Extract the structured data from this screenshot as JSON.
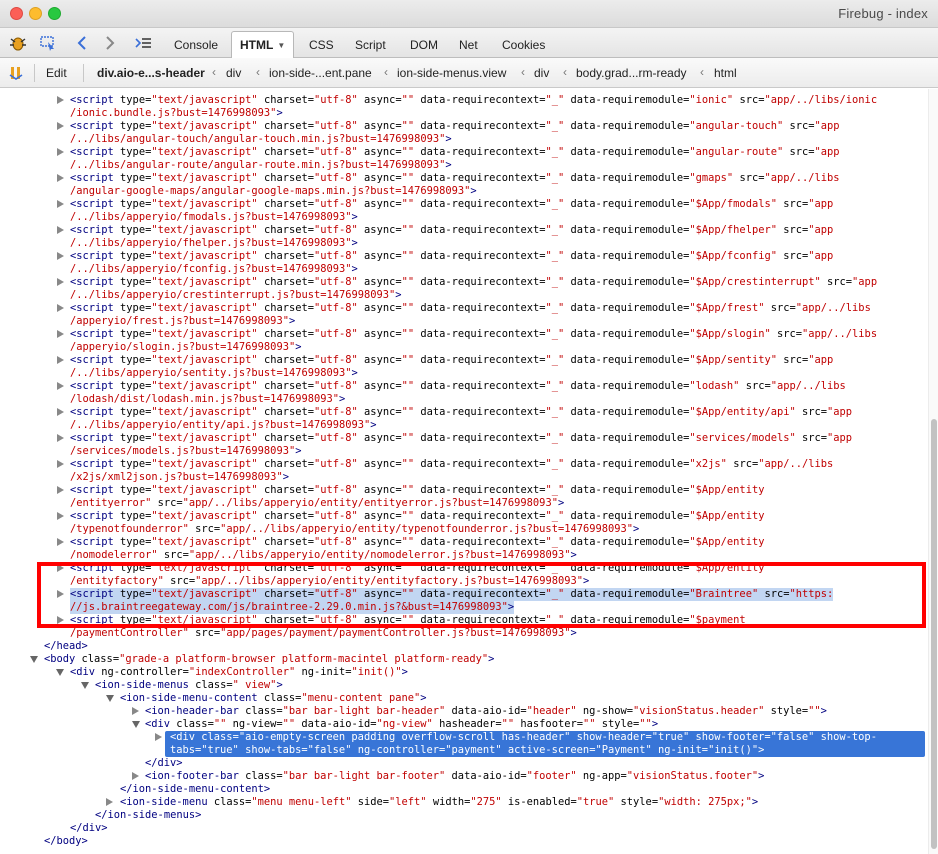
{
  "window": {
    "title": "Firebug - index"
  },
  "toolbar": {
    "tabs": [
      {
        "label": "Console"
      },
      {
        "label": "HTML",
        "active": true,
        "caret": "▼"
      },
      {
        "label": "CSS"
      },
      {
        "label": "Script"
      },
      {
        "label": "DOM"
      },
      {
        "label": "Net"
      },
      {
        "label": "Cookies"
      }
    ]
  },
  "breadcrumb": {
    "edit_label": "Edit",
    "items": [
      "div.aio-e...s-header",
      "div",
      "ion-side-...ent.pane",
      "ion-side-menus.view",
      "div",
      "body.grad...rm-ready",
      "html"
    ],
    "separator": "‹"
  },
  "code": {
    "script_lines": [
      [
        "ionic",
        "app/../libs/ionic",
        "/ionic.bundle.js?bust=1476998093\">"
      ],
      [
        "angular-touch",
        "app",
        "/../libs/angular-touch/angular-touch.min.js?bust=1476998093\">"
      ],
      [
        "angular-route",
        "app",
        "/../libs/angular-route/angular-route.min.js?bust=1476998093\">"
      ],
      [
        "gmaps",
        "app/../libs",
        "/angular-google-maps/angular-google-maps.min.js?bust=1476998093\">"
      ],
      [
        "$App/fmodals",
        "app",
        "/../libs/apperyio/fmodals.js?bust=1476998093\">"
      ],
      [
        "$App/fhelper",
        "app",
        "/../libs/apperyio/fhelper.js?bust=1476998093\">"
      ],
      [
        "$App/fconfig",
        "app",
        "/../libs/apperyio/fconfig.js?bust=1476998093\">"
      ],
      [
        "$App/crestinterrupt",
        "app",
        "/../libs/apperyio/crestinterrupt.js?bust=1476998093\">"
      ],
      [
        "$App/frest",
        "app/../libs",
        "/apperyio/frest.js?bust=1476998093\">"
      ],
      [
        "$App/slogin",
        "app/../libs",
        "/apperyio/slogin.js?bust=1476998093\">"
      ],
      [
        "$App/sentity",
        "app",
        "/../libs/apperyio/sentity.js?bust=1476998093\">"
      ],
      [
        "lodash",
        "app/../libs",
        "/lodash/dist/lodash.min.js?bust=1476998093\">"
      ],
      [
        "$App/entity/api",
        "app",
        "/../libs/apperyio/entity/api.js?bust=1476998093\">"
      ],
      [
        "services/models",
        "app",
        "/services/models.js?bust=1476998093\">"
      ],
      [
        "x2js",
        "app/../libs",
        "/x2js/xml2json.js?bust=1476998093\">"
      ]
    ],
    "prefix_text": "<script type=\"text/javascript\" charset=\"utf-8\" async=\"\" data-requirecontext=\"_\" data-requiremodule=",
    "entity_lines": [
      {
        "module": "\"$App/entity",
        "cont": "/entityerror\" src=\"app/../libs/apperyio/entity/entityerror.js?bust=1476998093\">"
      },
      {
        "module": "\"$App/entity",
        "cont": "/typenotfounderror\" src=\"app/../libs/apperyio/entity/typenotfounderror.js?bust=1476998093\">"
      },
      {
        "module": "\"$App/entity",
        "cont": "/nomodelerror\" src=\"app/../libs/apperyio/entity/nomodelerror.js?bust=1476998093\">"
      },
      {
        "module": "\"$App/entity",
        "cont": "/entityfactory\" src=\"app/../libs/apperyio/entity/entityfactory.js?bust=1476998093\">"
      }
    ],
    "braintree": {
      "module": "\"Braintree\"",
      "src_start": "\"https:",
      "src_cont": "//js.braintreegateway.com/js/braintree-2.29.0.min.js?&bust=1476998093\">"
    },
    "payment": {
      "module": "\"$payment",
      "cont": "/paymentController\" src=\"app/pages/payment/paymentController.js?bust=1476998093\">"
    },
    "tail": [
      "</head>",
      "<body class=\"grade-a platform-browser platform-macintel platform-ready\">",
      "<div ng-controller=\"indexController\" ng-init=\"init()\">",
      "<ion-side-menus class=\" view\">",
      "<ion-side-menu-content class=\"menu-content pane\">",
      "<ion-header-bar class=\"bar bar-light bar-header\" data-aio-id=\"header\" ng-show=\"visionStatus.header\" style=\"\">",
      "<div class=\"\" ng-view=\"\" data-aio-id=\"ng-view\" hasheader=\"\" hasfooter=\"\" style=\"\">",
      "<div class=\"aio-empty-screen padding overflow-scroll has-header\" show-header=\"true\" show-footer=\"false\" show-top-",
      "tabs=\"true\" show-tabs=\"false\" ng-controller=\"payment\" active-screen=\"Payment\" ng-init=\"init()\">",
      "</div>",
      "<ion-footer-bar class=\"bar bar-light bar-footer\" data-aio-id=\"footer\" ng-app=\"visionStatus.footer\">",
      "</ion-side-menu-content>",
      "<ion-side-menu class=\"menu menu-left\" side=\"left\" width=\"275\" is-enabled=\"true\" style=\"width: 275px;\">",
      "</ion-side-menus>",
      "</div>",
      "</body>"
    ]
  },
  "colors": {
    "tag": "#000080",
    "value": "#c00000",
    "highlight": "#3875d7",
    "annotation": "#ff0000"
  }
}
